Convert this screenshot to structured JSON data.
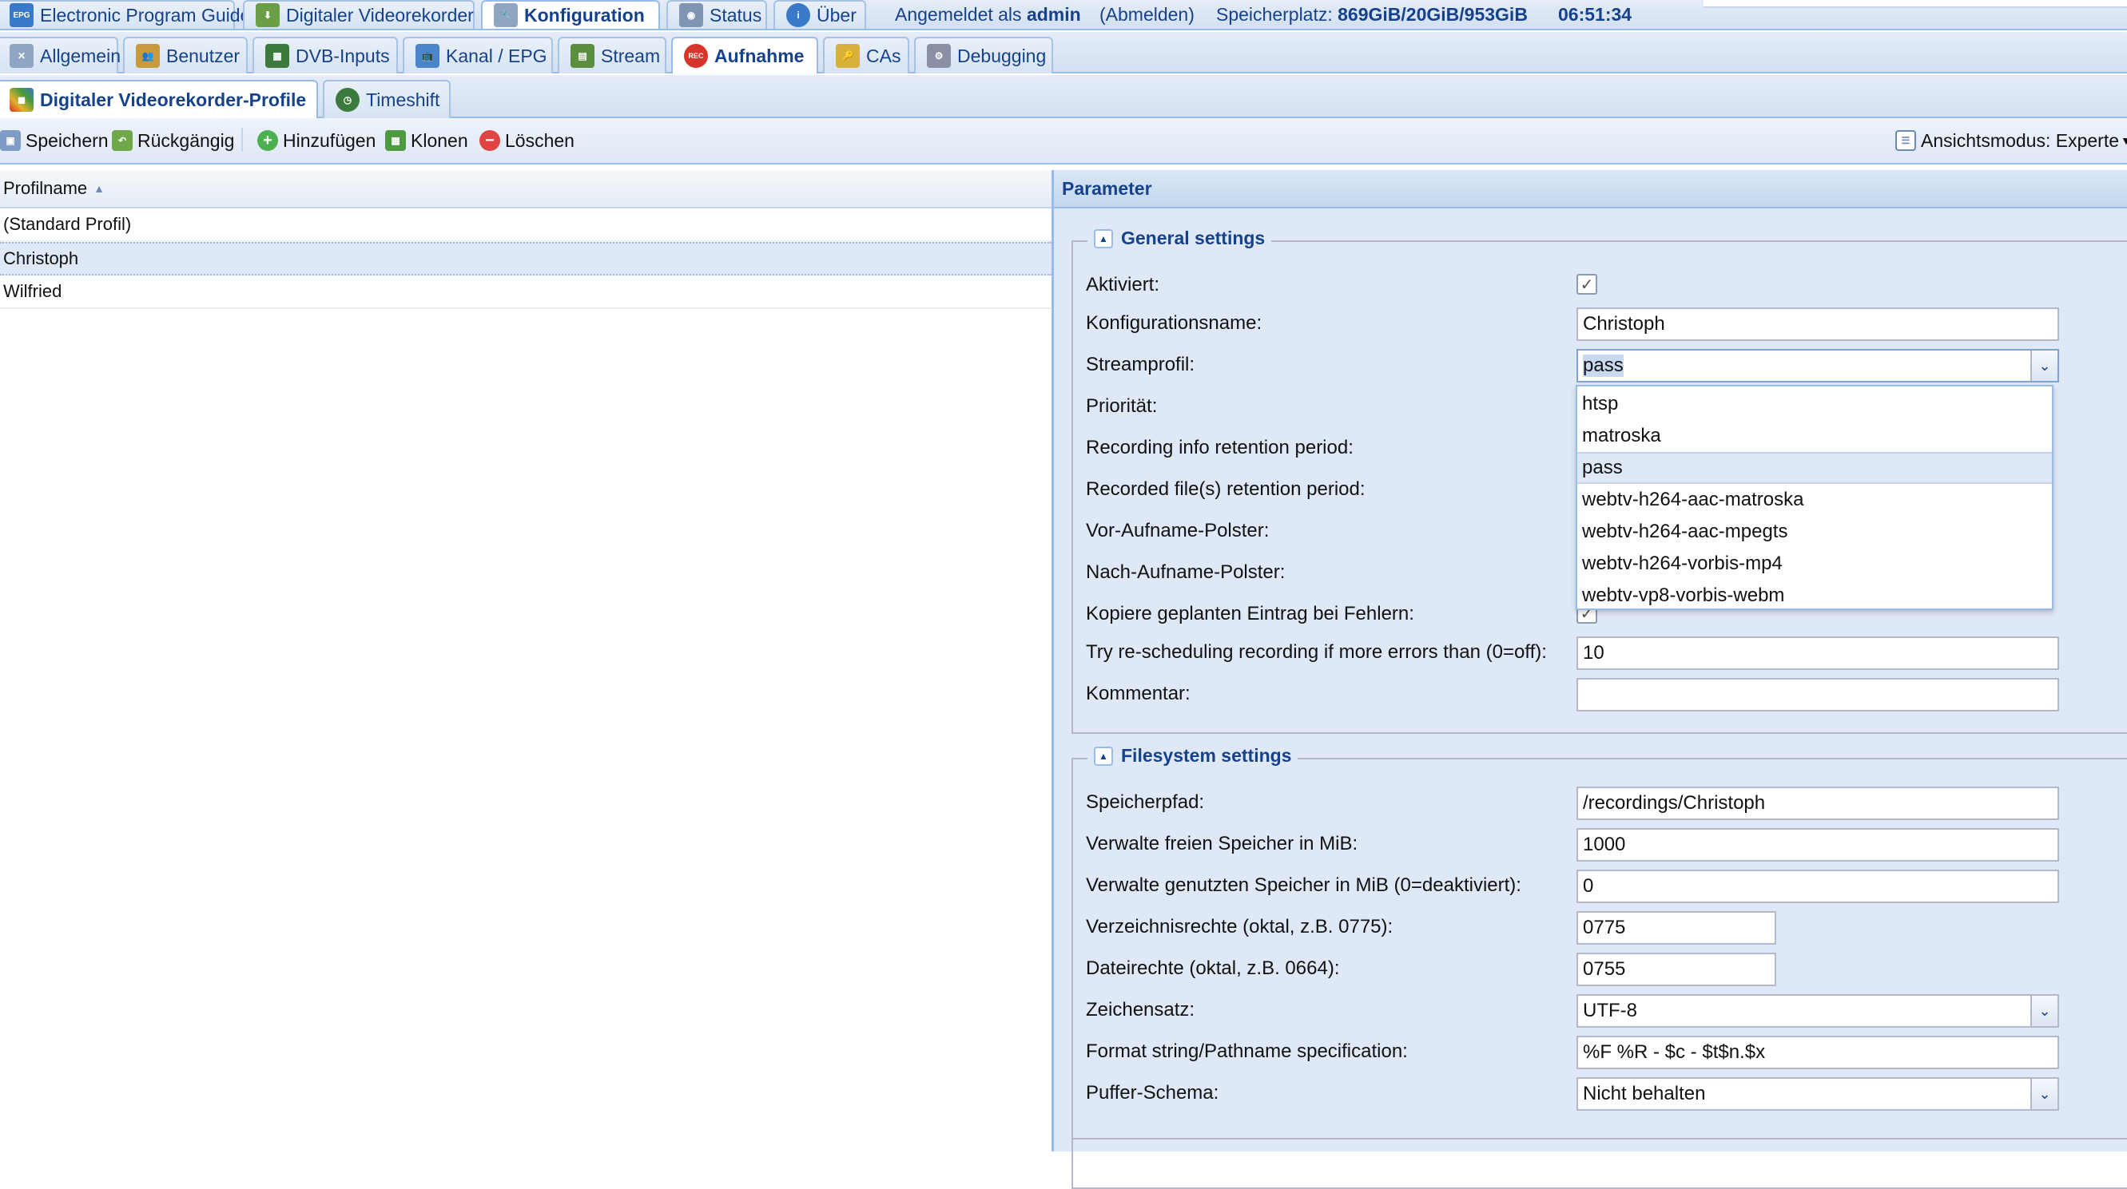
{
  "top_tabs": [
    {
      "label": "Electronic Program Guide",
      "icon": "epg-icon"
    },
    {
      "label": "Digitaler Videorekorder",
      "icon": "download-icon"
    },
    {
      "label": "Konfiguration",
      "icon": "wrench-icon",
      "active": true
    },
    {
      "label": "Status",
      "icon": "eye-icon"
    },
    {
      "label": "Über",
      "icon": "info-icon"
    }
  ],
  "session": {
    "logged_in_prefix": "Angemeldet als",
    "user": "admin",
    "logout": "(Abmelden)",
    "storage_label": "Speicherplatz:",
    "storage_value": "869GiB/20GiB/953GiB",
    "time": "06:51:34"
  },
  "config_tabs": [
    {
      "label": "Allgemein",
      "icon": "tools-icon"
    },
    {
      "label": "Benutzer",
      "icon": "users-icon"
    },
    {
      "label": "DVB-Inputs",
      "icon": "card-icon"
    },
    {
      "label": "Kanal / EPG",
      "icon": "tv-icon"
    },
    {
      "label": "Stream",
      "icon": "stream-icon"
    },
    {
      "label": "Aufnahme",
      "icon": "rec-icon",
      "active": true
    },
    {
      "label": "CAs",
      "icon": "key-icon"
    },
    {
      "label": "Debugging",
      "icon": "bug-icon"
    }
  ],
  "sub_tabs": [
    {
      "label": "Digitaler Videorekorder-Profile",
      "icon": "palette-icon",
      "active": true
    },
    {
      "label": "Timeshift",
      "icon": "clock-icon"
    }
  ],
  "toolbar": {
    "save": "Speichern",
    "undo": "Rückgängig",
    "add": "Hinzufügen",
    "clone": "Klonen",
    "delete": "Löschen",
    "view_mode": "Ansichtsmodus: Experte"
  },
  "grid": {
    "column": "Profilname",
    "rows": [
      "(Standard Profil)",
      "Christoph",
      "Wilfried"
    ],
    "selected": "Christoph"
  },
  "panel": {
    "title": "Parameter",
    "general": {
      "legend": "General settings",
      "labels": {
        "enabled": "Aktiviert:",
        "config_name": "Konfigurationsname:",
        "stream_profile": "Streamprofil:",
        "priority": "Priorität:",
        "info_retention": "Recording info retention period:",
        "file_retention": "Recorded file(s) retention period:",
        "pre_padding": "Vor-Aufname-Polster:",
        "post_padding": "Nach-Aufname-Polster:",
        "clone_on_error": "Kopiere geplanten Eintrag bei Fehlern:",
        "reschedule": "Try re-scheduling recording if more errors than (0=off):",
        "comment": "Kommentar:"
      },
      "values": {
        "enabled": true,
        "clone_on_error": true,
        "config_name": "Christoph",
        "stream_profile": "pass",
        "reschedule": "10",
        "comment": ""
      }
    },
    "filesystem": {
      "legend": "Filesystem settings",
      "labels": {
        "path": "Speicherpfad:",
        "free_space": "Verwalte freien Speicher in MiB:",
        "used_space": "Verwalte genutzten Speicher in MiB (0=deaktiviert):",
        "dir_perms": "Verzeichnisrechte (oktal, z.B. 0775):",
        "file_perms": "Dateirechte (oktal, z.B. 0664):",
        "charset": "Zeichensatz:",
        "format": "Format string/Pathname specification:",
        "cache": "Puffer-Schema:"
      },
      "values": {
        "path": "/recordings/Christoph",
        "free_space": "1000",
        "used_space": "0",
        "dir_perms": "0775",
        "file_perms": "0755",
        "charset": "UTF-8",
        "format": "%F %R - $c - $t$n.$x",
        "cache": "Nicht behalten"
      }
    }
  },
  "stream_profile_options": [
    "htsp",
    "matroska",
    "pass",
    "webtv-h264-aac-matroska",
    "webtv-h264-aac-mpegts",
    "webtv-h264-vorbis-mp4",
    "webtv-vp8-vorbis-webm"
  ],
  "colors": {
    "accent": "#15428b",
    "border": "#99bbe8",
    "panel_bg": "#dfe8f6",
    "rec": "#d9342b"
  }
}
